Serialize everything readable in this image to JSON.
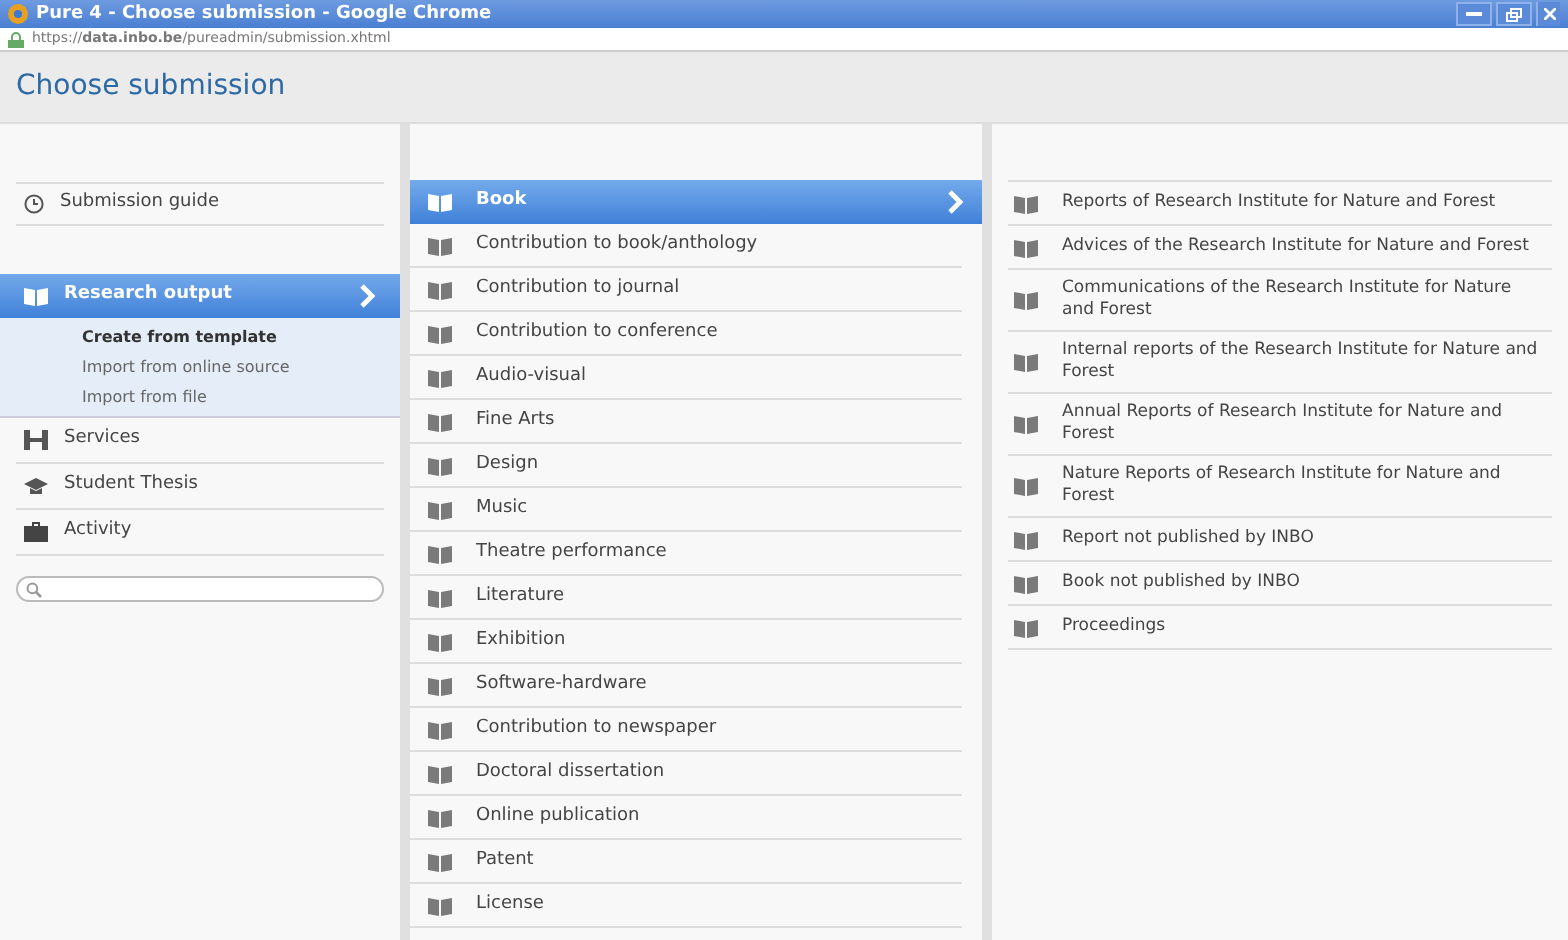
{
  "window": {
    "title": "Pure 4 - Choose submission - Google Chrome"
  },
  "address_bar": {
    "url": "https://**data.inbo.be**/pureadmin/submission.xhtml"
  },
  "page_title": "Choose submission",
  "sidebar": {
    "guide": {
      "label": "Submission guide"
    },
    "items": [
      {
        "label": "Research output",
        "selected": true,
        "children": [
          {
            "label": "Create from template",
            "selected": true
          },
          {
            "label": "Import from online source",
            "selected": false
          },
          {
            "label": "Import from file",
            "selected": false
          }
        ]
      },
      {
        "label": "Services",
        "selected": false
      },
      {
        "label": "Student Thesis",
        "selected": false
      },
      {
        "label": "Activity",
        "selected": false
      }
    ]
  },
  "categories": [
    {
      "label": "Book",
      "selected": true
    },
    {
      "label": "Contribution to book/anthology",
      "selected": false
    },
    {
      "label": "Contribution to journal",
      "selected": false
    },
    {
      "label": "Contribution to conference",
      "selected": false
    },
    {
      "label": "Audio-visual",
      "selected": false
    },
    {
      "label": "Fine Arts",
      "selected": false
    },
    {
      "label": "Design",
      "selected": false
    },
    {
      "label": "Music",
      "selected": false
    },
    {
      "label": "Theatre performance",
      "selected": false
    },
    {
      "label": "Literature",
      "selected": false
    },
    {
      "label": "Exhibition",
      "selected": false
    },
    {
      "label": "Software-hardware",
      "selected": false
    },
    {
      "label": "Contribution to newspaper",
      "selected": false
    },
    {
      "label": "Doctoral dissertation",
      "selected": false
    },
    {
      "label": "Online publication",
      "selected": false
    },
    {
      "label": "Patent",
      "selected": false
    },
    {
      "label": "License",
      "selected": false
    }
  ],
  "subtypes": [
    {
      "label": "Reports of Research Institute for Nature and Forest"
    },
    {
      "label": "Advices of the Research Institute for Nature and Forest"
    },
    {
      "label": "Communications of the Research Institute for Nature and Forest"
    },
    {
      "label": "Internal reports of the Research Institute for Nature and Forest"
    },
    {
      "label": "Annual Reports of Research Institute for Nature and Forest"
    },
    {
      "label": "Nature Reports of Research Institute for Nature and Forest"
    },
    {
      "label": "Report not published by INBO"
    },
    {
      "label": "Book not published by INBO"
    },
    {
      "label": "Proceedings"
    }
  ]
}
